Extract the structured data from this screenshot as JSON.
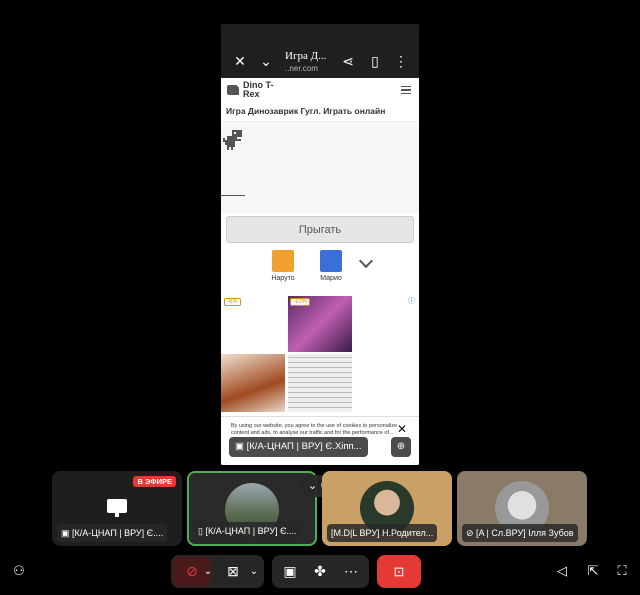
{
  "shared_screen": {
    "tab_title": "Игра Д...",
    "domain": "..ner.com",
    "site_logo": "Dino T-Rex",
    "page_title": "Игра Динозаврик Гугл. Играть онлайн",
    "jump_label": "Прыгать",
    "games": [
      {
        "label": "Наруто",
        "color": "#f0a030"
      },
      {
        "label": "Марио",
        "color": "#3a6fd8"
      }
    ],
    "ad_badges": [
      "-6%",
      "-10%"
    ],
    "cookie_text": "By using our website, you agree to the use of cookies to personalize content and ads, to analyse our traffic and for the performance of...",
    "presenter_label": "[К/А-ЦНАП | ВРУ] Є.Хіпп..."
  },
  "participants": [
    {
      "label": "[К/А-ЦНАП | ВРУ] Є....",
      "live": "В ЭФИРЕ",
      "icon": "monitor-icon"
    },
    {
      "label": "[К/А-ЦНАП | ВРУ] Є....",
      "icon": "phone-icon"
    },
    {
      "label": "[M.D|L ВРУ] Н.Родител..."
    },
    {
      "label": "[A | Сл.ВРУ] Ілля Зубов",
      "icon": "mic-off-icon"
    }
  ],
  "colors": {
    "accent_red": "#e53935",
    "tile_bg": "#2a2a2a",
    "toolbar_bg": "#262626",
    "active_border": "#4caf50"
  }
}
